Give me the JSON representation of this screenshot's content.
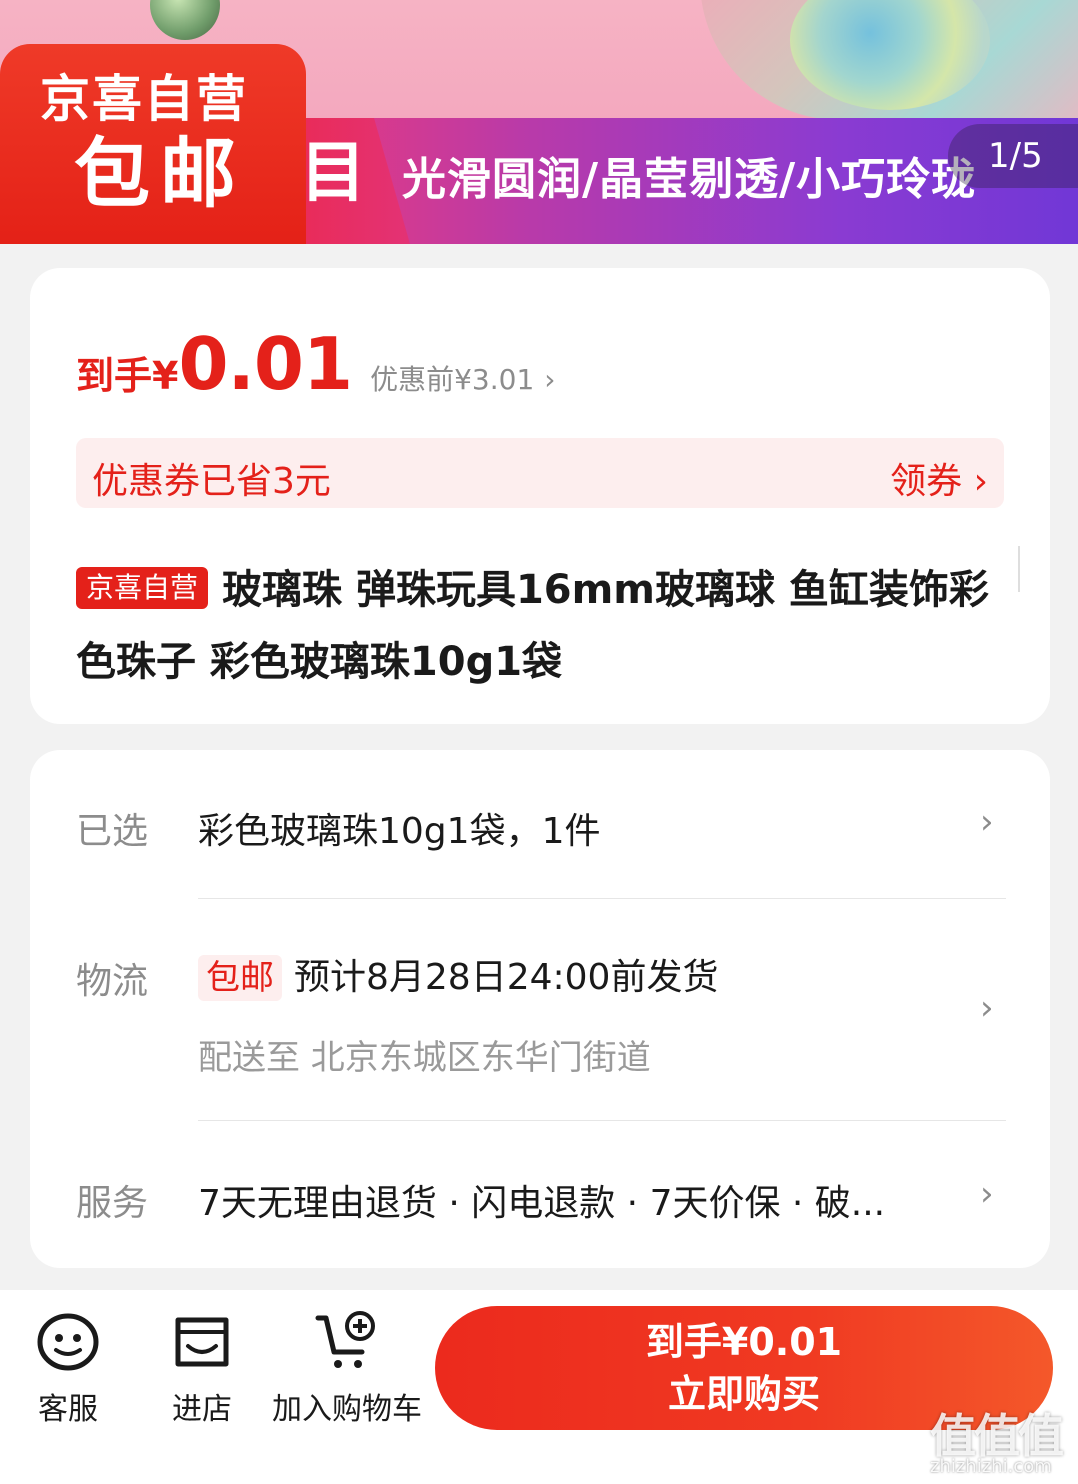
{
  "banner": {
    "badge_line1": "京喜自营",
    "badge_line2": "包邮",
    "stripe_char": "目",
    "slogan": "光滑圆润/晶莹剔透/小巧玲珑",
    "counter": "1/5"
  },
  "price_card": {
    "price_prefix": "到手¥",
    "price_value": "0.01",
    "price_before": "优惠前¥3.01",
    "coupon_text": "优惠券已省3元",
    "coupon_link": "领券 ›",
    "self_tag": "京喜自营",
    "title": "玻璃珠 弹珠玩具16mm玻璃球 鱼缸装饰彩色珠子 彩色玻璃珠10g1袋"
  },
  "info_card": {
    "selected_label": "已选",
    "selected_value": "彩色玻璃珠10g1袋，1件",
    "logistics_label": "物流",
    "logistics_tag": "包邮",
    "logistics_value": "预计8月28日24:00前发货",
    "delivery_to": "配送至  北京东城区东华门街道",
    "service_label": "服务",
    "service_value": "7天无理由退货 · 闪电退款 · 7天价保 · 破..."
  },
  "bottom_bar": {
    "service_label": "客服",
    "store_label": "进店",
    "cart_label": "加入购物车",
    "buy_price": "到手¥0.01",
    "buy_label": "立即购买"
  },
  "watermark": {
    "text": "值值值",
    "domain": "zhizhizhi.com"
  },
  "colors": {
    "accent": "#e4211a",
    "coupon_bg": "#fdeeee",
    "page_bg": "#f2f2f2"
  }
}
